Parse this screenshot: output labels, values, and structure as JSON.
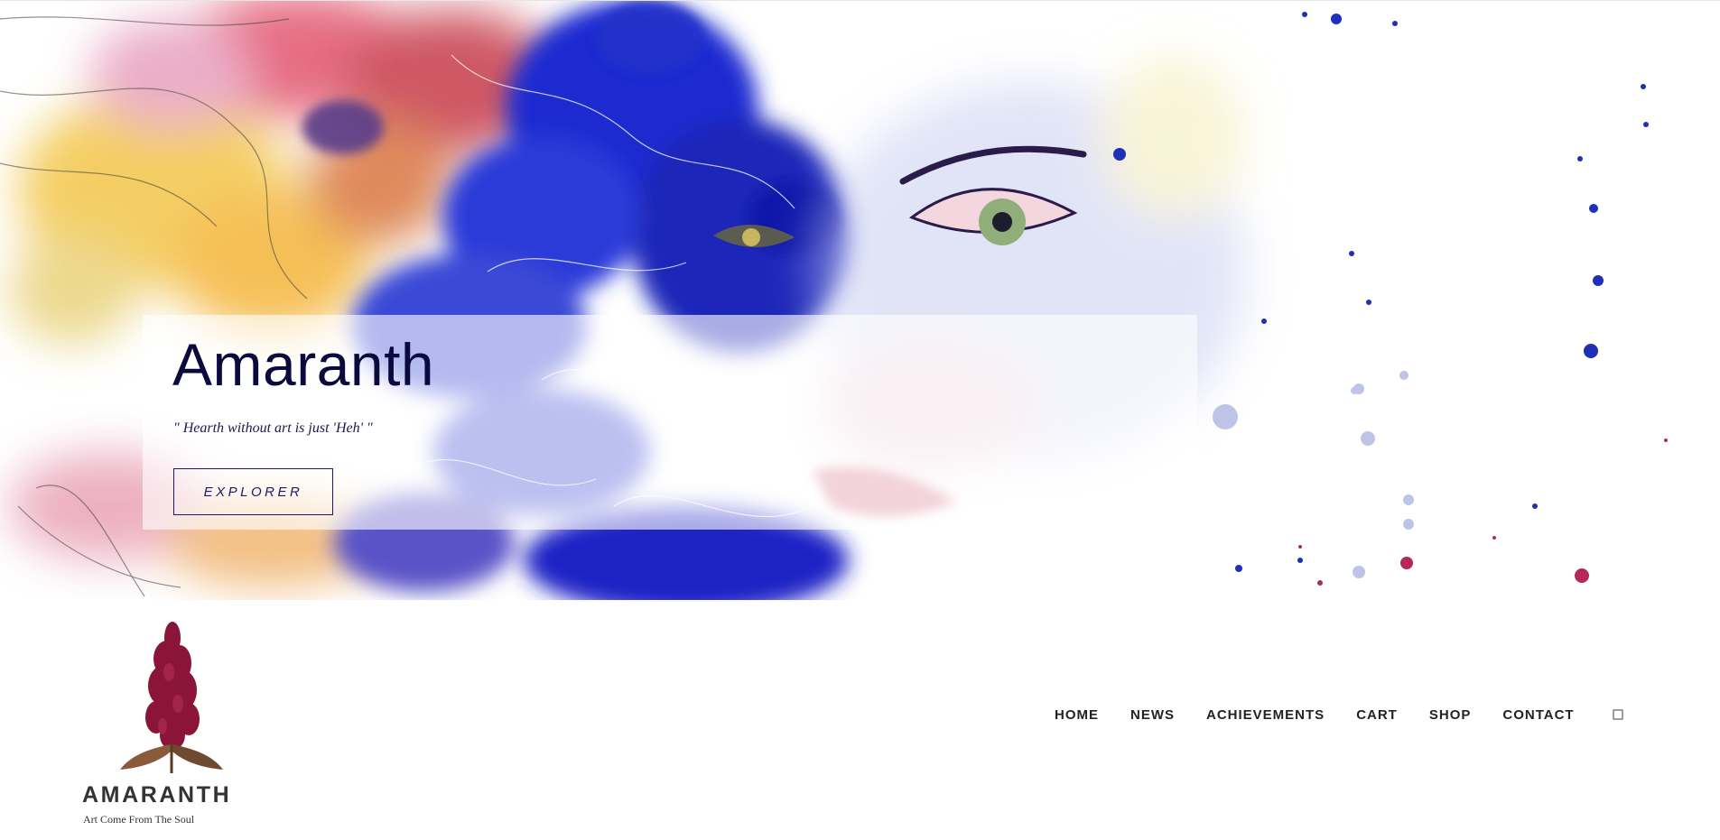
{
  "hero": {
    "title": "Amaranth",
    "quote": "\" Hearth without art is just 'Heh' \"",
    "button_label": "EXPLORER"
  },
  "header": {
    "site_title": "AMARANTH",
    "tagline": "Art Come From The Soul",
    "nav": [
      {
        "label": "HOME"
      },
      {
        "label": "NEWS"
      },
      {
        "label": "ACHIEVEMENTS"
      },
      {
        "label": "CART"
      },
      {
        "label": "SHOP"
      },
      {
        "label": "CONTACT"
      }
    ],
    "search_icon": "search-icon"
  },
  "colors": {
    "title": "#0b0a3f",
    "button_border": "#1c1a66",
    "nav_text": "#222222",
    "brand_text": "#333333",
    "logo_flower": "#8a1538",
    "art_blue": "#1f2fc0"
  }
}
